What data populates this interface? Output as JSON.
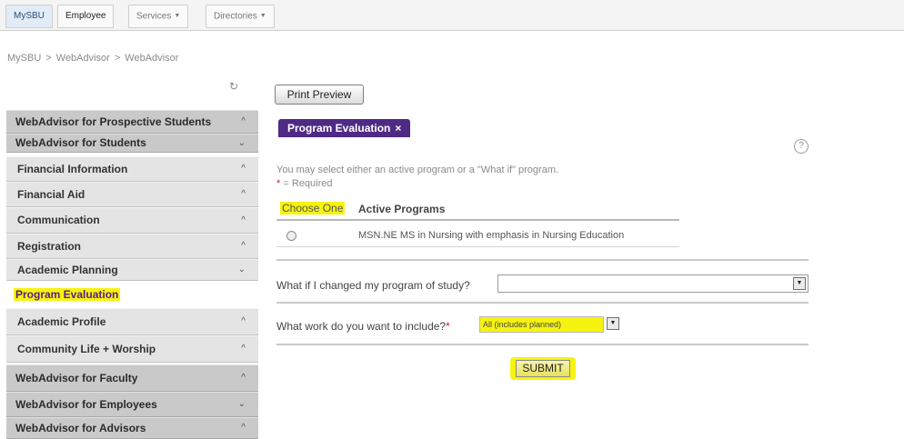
{
  "topnav": {
    "tabs": [
      {
        "label": "MySBU"
      },
      {
        "label": "Employee"
      },
      {
        "label": "Services"
      },
      {
        "label": "Directories"
      }
    ]
  },
  "breadcrumb": [
    "MySBU",
    "WebAdvisor",
    "WebAdvisor"
  ],
  "breadcrumb_sep": ">",
  "sidebar": {
    "refresh_icon": "↻",
    "sections": [
      {
        "label": "WebAdvisor for Prospective Students",
        "arrow": "^"
      },
      {
        "label": "WebAdvisor for Students",
        "arrow": "⌄"
      },
      {
        "label": "WebAdvisor for Faculty",
        "arrow": "^"
      },
      {
        "label": "WebAdvisor for Employees",
        "arrow": "⌄"
      },
      {
        "label": "WebAdvisor for Advisors",
        "arrow": "^"
      }
    ],
    "items": [
      {
        "label": "Financial Information",
        "arrow": "^"
      },
      {
        "label": "Financial Aid",
        "arrow": "^"
      },
      {
        "label": "Communication",
        "arrow": "^"
      },
      {
        "label": "Registration",
        "arrow": "^"
      },
      {
        "label": "Academic Planning",
        "arrow": "⌄"
      },
      {
        "label": "Program Evaluation"
      },
      {
        "label": "Academic Profile",
        "arrow": "^"
      },
      {
        "label": "Community Life + Worship",
        "arrow": "^"
      }
    ]
  },
  "main": {
    "print_preview": "Print Preview",
    "tab_label": "Program Evaluation",
    "tab_close": "×",
    "help_icon": "?",
    "intro": "You may select either an active program or a \"What if\" program.",
    "required_star": "*",
    "required_text": "= Required",
    "table": {
      "col_choose": "Choose One",
      "col_programs": "Active Programs",
      "rows": [
        {
          "program": "MSN.NE MS in Nursing with emphasis in Nursing Education"
        }
      ]
    },
    "whatif_label": "What if I changed my program of study?",
    "whatif_value": "",
    "work_label": "What work do you want to include?",
    "work_star": "*",
    "work_value": "All (includes planned)",
    "submit": "SUBMIT"
  },
  "colors": {
    "highlight": "#f7f311",
    "tab_purple": "#4e2a84",
    "section_gray": "#c9c9c9"
  }
}
